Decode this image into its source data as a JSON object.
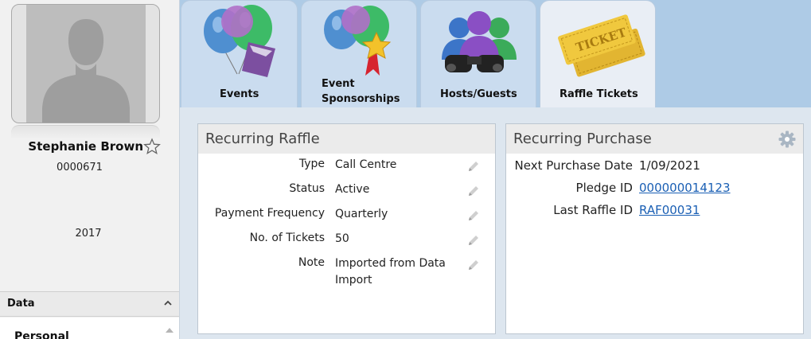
{
  "profile": {
    "avatar_icon": "person-silhouette-icon",
    "name": "Stephanie Brown",
    "favorite_icon": "star-outline-icon",
    "id": "0000671",
    "year": "2017"
  },
  "sidebar": {
    "section_label": "Data",
    "collapse_icon": "chevron-up-icon",
    "first_item_label": "Personal"
  },
  "tabs": [
    {
      "label_line1": "Events",
      "label_line2": "",
      "icon": "balloons-invitation-icon"
    },
    {
      "label_line1": "Event",
      "label_line2": "Sponsorships",
      "icon": "balloons-award-ribbon-icon"
    },
    {
      "label_line1": "Hosts/Guests",
      "label_line2": "",
      "icon": "people-binoculars-icon"
    },
    {
      "label_line1": "Raffle Tickets",
      "label_line2": "",
      "icon": "raffle-tickets-icon",
      "active": true
    }
  ],
  "recurring_raffle": {
    "title": "Recurring Raffle",
    "edit_icon": "pencil-icon",
    "fields": [
      {
        "label": "Type",
        "value": "Call Centre"
      },
      {
        "label": "Status",
        "value": "Active"
      },
      {
        "label": "Payment Frequency",
        "value": "Quarterly"
      },
      {
        "label": "No. of Tickets",
        "value": "50"
      },
      {
        "label": "Note",
        "value_line1": "Imported from Data",
        "value_line2": "Import"
      }
    ]
  },
  "recurring_purchase": {
    "title": "Recurring Purchase",
    "settings_icon": "gear-icon",
    "fields": [
      {
        "label": "Next Purchase Date",
        "value": "1/09/2021"
      },
      {
        "label": "Pledge ID",
        "value": "000000014123"
      },
      {
        "label": "Last Raffle ID",
        "value": "RAF00031"
      }
    ]
  },
  "colors": {
    "link": "#1a5fb4",
    "tab_strip": "#aecbe6",
    "tab": "#cadcef",
    "content_bg": "#dde6ef",
    "panel_header": "#ebebeb"
  }
}
